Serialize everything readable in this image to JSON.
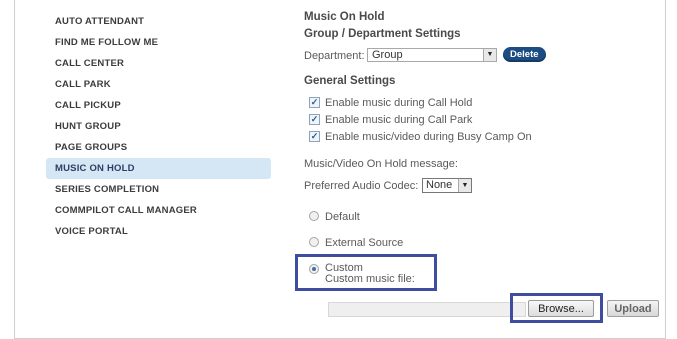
{
  "sidebar": {
    "items": [
      {
        "label": "AUTO ATTENDANT"
      },
      {
        "label": "FIND ME FOLLOW ME"
      },
      {
        "label": "CALL CENTER"
      },
      {
        "label": "CALL PARK"
      },
      {
        "label": "CALL PICKUP"
      },
      {
        "label": "HUNT GROUP"
      },
      {
        "label": "PAGE GROUPS"
      },
      {
        "label": "MUSIC ON HOLD",
        "active": true
      },
      {
        "label": "SERIES COMPLETION"
      },
      {
        "label": "COMMPILOT CALL MANAGER"
      },
      {
        "label": "VOICE PORTAL"
      }
    ]
  },
  "main": {
    "page_title": "Music On Hold",
    "section_title": "Group / Department Settings",
    "department": {
      "label": "Department:",
      "value": "Group",
      "delete_label": "Delete"
    },
    "general_title": "General Settings",
    "checkboxes": [
      {
        "label": "Enable music during Call Hold",
        "checked": true
      },
      {
        "label": "Enable music during Call Park",
        "checked": true
      },
      {
        "label": "Enable music/video during Busy Camp On",
        "checked": true
      }
    ],
    "message_label": "Music/Video On Hold message:",
    "codec": {
      "label": "Preferred Audio Codec:",
      "value": "None"
    },
    "radios": [
      {
        "label": "Default",
        "checked": false
      },
      {
        "label": "External Source",
        "checked": false
      },
      {
        "label": "Custom",
        "sublabel": "Custom music file:",
        "checked": true
      }
    ],
    "browse_label": "Browse...",
    "upload_label": "Upload"
  },
  "colors": {
    "accent": "#1d4c83",
    "active_sidebar_bg": "#d5e6f4",
    "highlight_border": "#3f4d9e"
  }
}
